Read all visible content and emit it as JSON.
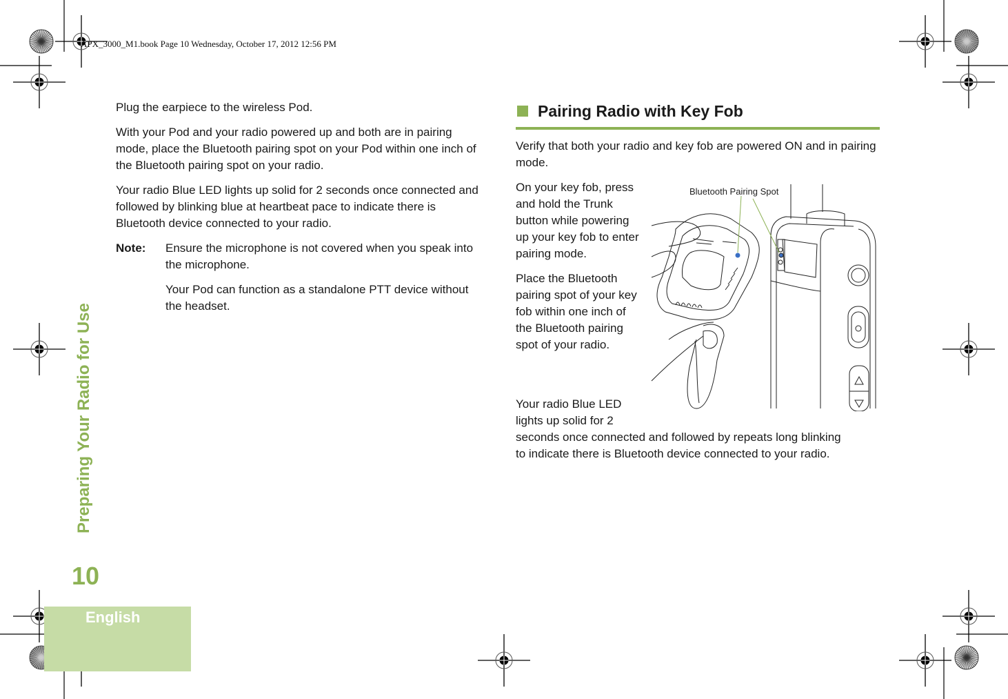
{
  "header": {
    "stamp": "APX_3000_M1.book  Page 10  Wednesday, October 17, 2012  12:56 PM"
  },
  "sidebar": {
    "chapter_title": "Preparing Your Radio for Use",
    "page_number": "10",
    "language": "English"
  },
  "left_column": {
    "paragraphs": [
      "Plug the earpiece to the wireless Pod.",
      "With your Pod and your radio powered up and both are in pairing mode, place the Bluetooth pairing spot on your Pod within one inch of the Bluetooth pairing spot on your radio.",
      "Your radio Blue LED lights up solid for 2 seconds once connected and followed by blinking blue at heartbeat pace to indicate there is Bluetooth device connected to your radio."
    ],
    "note": {
      "label": "Note:",
      "lines": [
        "Ensure the microphone is not covered when you speak into the microphone.",
        "Your Pod can function as a standalone PTT device without the headset."
      ]
    }
  },
  "right_column": {
    "section_title": "Pairing Radio with Key Fob",
    "intro": "Verify that both your radio and key fob are powered ON and in pairing mode.",
    "steps": [
      "On your key fob, press and hold the Trunk button while powering up your key fob to enter pairing mode.",
      "Place the Bluetooth pairing spot of your key fob within one inch of the Bluetooth pairing spot of your radio."
    ],
    "final_lines": [
      "Your radio Blue LED",
      "lights up solid for 2",
      "seconds once connected and followed by repeats long blinking",
      "to indicate there is Bluetooth device connected to your radio."
    ],
    "figure": {
      "caption": "Bluetooth Pairing Spot",
      "accent_color": "#8db255",
      "spot_color": "#3a6fc4"
    }
  },
  "colors": {
    "brand_green": "#8db255",
    "language_box": "#c6dca6"
  }
}
